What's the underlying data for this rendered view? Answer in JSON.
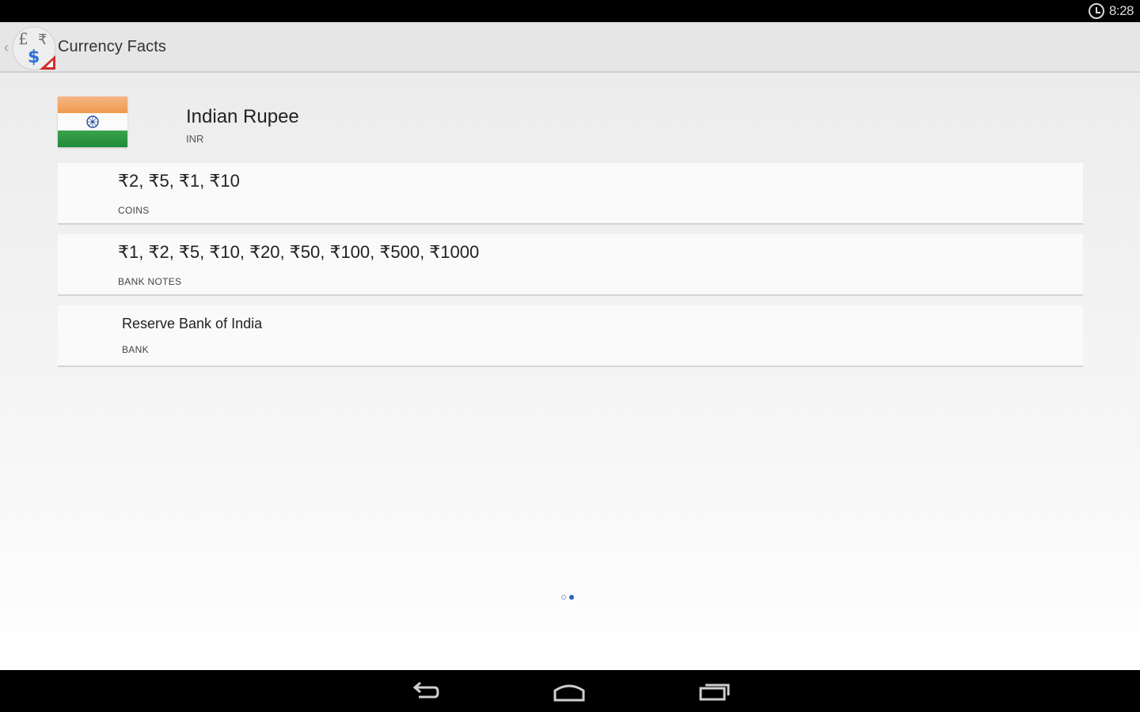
{
  "status_bar": {
    "time": "8:28",
    "icons": [
      "alarm-icon"
    ]
  },
  "action_bar": {
    "title": "Currency Facts",
    "icons": [
      "up-icon",
      "app-logo-icon"
    ]
  },
  "currency": {
    "name": "Indian Rupee",
    "code": "INR",
    "flag_icon": "india-flag-icon"
  },
  "cards": [
    {
      "value": "₹2, ₹5, ₹1, ₹10",
      "label": "COINS"
    },
    {
      "value": "₹1, ₹2, ₹5, ₹10, ₹20, ₹50, ₹100, ₹500, ₹1000",
      "label": "BANK NOTES"
    },
    {
      "value": "Reserve Bank of India",
      "label": "BANK"
    }
  ],
  "pager": {
    "total": 2,
    "current": 2
  },
  "nav_bar": {
    "buttons": [
      "back-icon",
      "home-icon",
      "recent-apps-icon"
    ]
  },
  "colors": {
    "saffron": "#ef9a4e",
    "green": "#1f8a39",
    "chakra_blue": "#2a4fa0",
    "pager_active": "#2c62b8"
  }
}
